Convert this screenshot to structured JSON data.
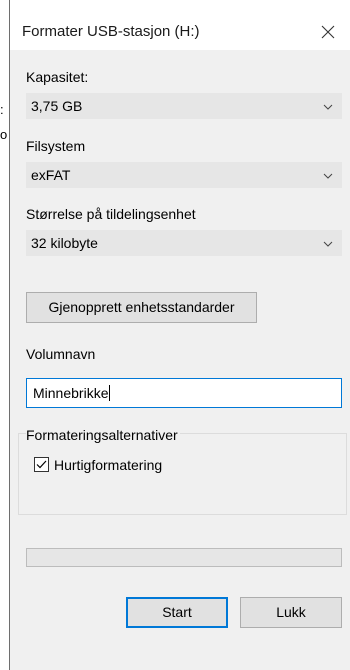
{
  "backdrop": {
    "glyph_1": ":",
    "glyph_2": "o"
  },
  "window": {
    "title": "Formater USB-stasjon (H:)",
    "close_glyph": "✕"
  },
  "capacity": {
    "label": "Kapasitet:",
    "value": "3,75 GB"
  },
  "filesystem": {
    "label": "Filsystem",
    "value": "exFAT"
  },
  "allocation": {
    "label": "Størrelse på tildelingsenhet",
    "value": "32 kilobyte"
  },
  "restore_button": "Gjenopprett enhetsstandarder",
  "volume": {
    "label": "Volumnavn",
    "value": "Minnebrikke"
  },
  "format_options": {
    "title": "Formateringsalternativer",
    "quick_format_label": "Hurtigformatering",
    "quick_format_checked": true
  },
  "progress": {
    "value": 0
  },
  "buttons": {
    "start": "Start",
    "close": "Lukk"
  },
  "colors": {
    "accent": "#0078d7",
    "dialog_bg": "#f0f0f0",
    "dropdown_bg": "#e6e6e6"
  }
}
